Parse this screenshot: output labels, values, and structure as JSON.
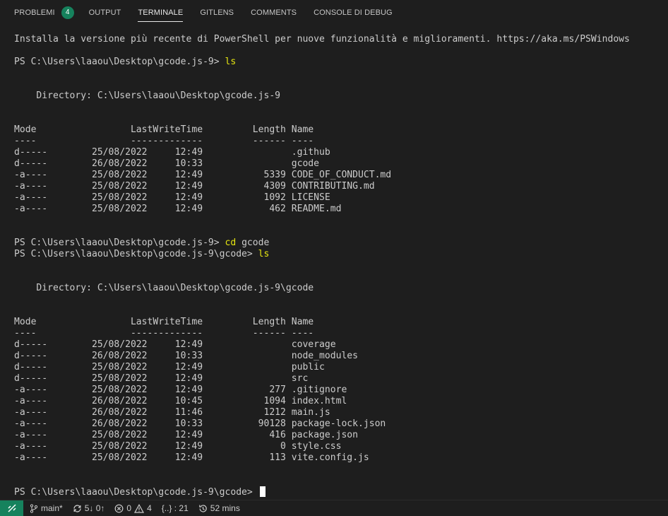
{
  "tabs": {
    "problems": "PROBLEMI",
    "problems_count": "4",
    "output": "OUTPUT",
    "terminal": "TERMINALE",
    "gitlens": "GITLENS",
    "comments": "COMMENTS",
    "debug_console": "CONSOLE DI DEBUG"
  },
  "terminal": {
    "lines": [
      "Installa la versione più recente di PowerShell per nuove funzionalità e miglioramenti. https://aka.ms/PSWindows",
      "",
      "PS C:\\Users\\laaou\\Desktop\\gcode.js-9> ",
      "",
      "",
      "    Directory: C:\\Users\\laaou\\Desktop\\gcode.js-9",
      "",
      "",
      "Mode                 LastWriteTime         Length Name",
      "----                 -------------         ------ ----",
      "d-----        25/08/2022     12:49                .github",
      "d-----        26/08/2022     10:33                gcode",
      "-a----        25/08/2022     12:49           5339 CODE_OF_CONDUCT.md",
      "-a----        25/08/2022     12:49           4309 CONTRIBUTING.md",
      "-a----        25/08/2022     12:49           1092 LICENSE",
      "-a----        25/08/2022     12:49            462 README.md",
      "",
      "",
      "PS C:\\Users\\laaou\\Desktop\\gcode.js-9> ",
      "PS C:\\Users\\laaou\\Desktop\\gcode.js-9\\gcode> ",
      "",
      "",
      "    Directory: C:\\Users\\laaou\\Desktop\\gcode.js-9\\gcode",
      "",
      "",
      "Mode                 LastWriteTime         Length Name",
      "----                 -------------         ------ ----",
      "d-----        25/08/2022     12:49                coverage",
      "d-----        26/08/2022     10:33                node_modules",
      "d-----        25/08/2022     12:49                public",
      "d-----        25/08/2022     12:49                src",
      "-a----        25/08/2022     12:49            277 .gitignore",
      "-a----        26/08/2022     10:45           1094 index.html",
      "-a----        26/08/2022     11:46           1212 main.js",
      "-a----        26/08/2022     10:33          90128 package-lock.json",
      "-a----        25/08/2022     12:49            416 package.json",
      "-a----        25/08/2022     12:49              0 style.css",
      "-a----        25/08/2022     12:49            113 vite.config.js",
      "",
      "",
      "PS C:\\Users\\laaou\\Desktop\\gcode.js-9\\gcode> "
    ],
    "commands": {
      "2": "ls",
      "18": "cd",
      "19": "ls"
    },
    "command_args": {
      "18": " gcode"
    }
  },
  "statusbar": {
    "branch": "main*",
    "sync": "5↓ 0↑",
    "errors": "0",
    "warnings": "4",
    "selection": "{..} : 21",
    "time": "52 mins"
  },
  "colors": {
    "accent": "#16825d",
    "command": "#e5e510",
    "background": "#1e1e1e",
    "text": "#cccccc"
  }
}
